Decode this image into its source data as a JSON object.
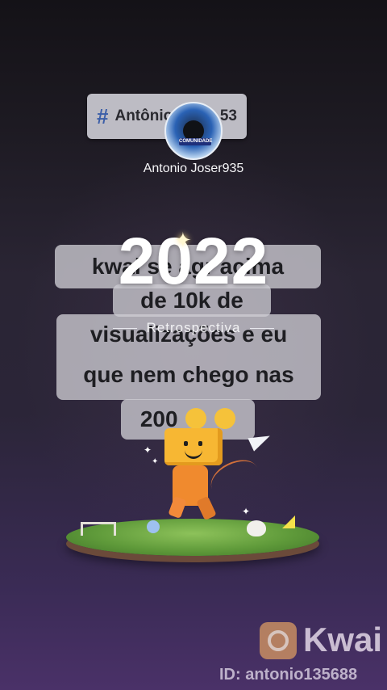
{
  "hashtag": {
    "symbol": "#",
    "text_left": "Antônio",
    "text_right": "53"
  },
  "avatar": {
    "banner": "COMUNIDADE"
  },
  "username": "Antonio Joser935",
  "overlay": {
    "year": "2022",
    "subtitle": "Retrospectiva"
  },
  "comment_lines": [
    "kwai se agr acima",
    "de 10k de",
    "visualizações e eu",
    "que nem chego nas",
    "200"
  ],
  "watermark": {
    "brand": "Kwai",
    "id_label": "ID: antonio135688"
  },
  "colors": {
    "background_top": "#141217",
    "background_bottom": "#4a3168",
    "bubble": "#cdccd2",
    "character_head": "#f7b733"
  },
  "icons": [
    "hashtag-icon",
    "sparkle-icon",
    "paper-plane-icon",
    "kwai-logo-icon",
    "laughing-emoji-icon"
  ]
}
